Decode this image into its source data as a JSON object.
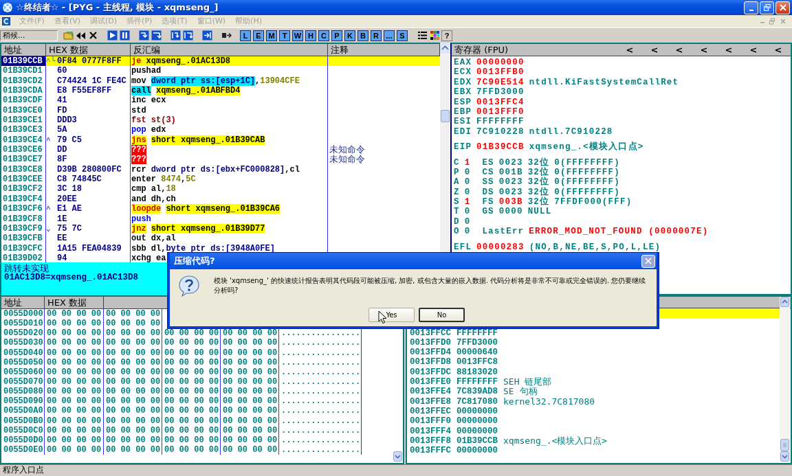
{
  "window": {
    "title": "☆终结者☆ - [PYG - 主线程, 模块 - xqmseng_]"
  },
  "menu": [
    {
      "label": "文件(F)",
      "disabled": true
    },
    {
      "label": "查看(V)",
      "disabled": true
    },
    {
      "label": "调试(D)",
      "disabled": true
    },
    {
      "label": "插件(P)",
      "disabled": true
    },
    {
      "label": "选项(T)",
      "disabled": true
    },
    {
      "label": "窗口(W)",
      "disabled": true
    },
    {
      "label": "帮助(H)",
      "disabled": true
    }
  ],
  "toolbar": {
    "status": "稍候...",
    "letter_buttons": [
      "L",
      "E",
      "M",
      "T",
      "W",
      "H",
      "C",
      "P",
      "K",
      "B",
      "R",
      "...",
      "S"
    ],
    "help_button": "?"
  },
  "disassembly": {
    "columns": [
      "地址",
      "HEX 数据",
      "反汇编",
      "注释"
    ],
    "rows": [
      {
        "address": "01B39CCB",
        "mark": "^╰",
        "hex": "0F84 0777F8FF",
        "selected": true,
        "code": [
          {
            "text": "je",
            "kind": "jump"
          },
          {
            "text": " xqmseng_.01AC13D8",
            "kind": "plain"
          }
        ]
      },
      {
        "address": "01B39CD1",
        "hex": "60",
        "selected": false,
        "code": [
          {
            "text": "pushad",
            "kind": "plain"
          }
        ]
      },
      {
        "address": "01B39CD2",
        "hex": "C74424 1C FE4C",
        "selected": false,
        "code": [
          {
            "text": "mov ",
            "kind": "plain"
          },
          {
            "text": "dword ptr ss:[esp+1C]",
            "kind": "memhl"
          },
          {
            "text": ",",
            "kind": "plain"
          },
          {
            "text": "13904CFE",
            "kind": "num"
          }
        ]
      },
      {
        "address": "01B39CDA",
        "hex": "E8 F55EF8FF",
        "selected": false,
        "code": [
          {
            "text": "call",
            "kind": "callhl"
          },
          {
            "text": "xqmseng_.01ABFBD4",
            "kind": "target"
          }
        ]
      },
      {
        "address": "01B39CDF",
        "hex": "41",
        "selected": false,
        "code": [
          {
            "text": "inc ecx",
            "kind": "plain"
          }
        ]
      },
      {
        "address": "01B39CE0",
        "hex": "FD",
        "selected": false,
        "code": [
          {
            "text": "std",
            "kind": "plain"
          }
        ]
      },
      {
        "address": "01B39CE1",
        "hex": "DDD3",
        "selected": false,
        "code": [
          {
            "text": "fst st(3)",
            "kind": "fpu"
          }
        ]
      },
      {
        "address": "01B39CE3",
        "hex": "5A",
        "selected": false,
        "code": [
          {
            "text": "pop",
            "kind": "stackop"
          },
          {
            "text": " edx",
            "kind": "plain"
          }
        ]
      },
      {
        "address": "01B39CE4",
        "mark": "^",
        "hex": "79 C5",
        "selected": false,
        "code": [
          {
            "text": "jns",
            "kind": "jump"
          },
          {
            "text": "short xqmseng_.01B39CAB",
            "kind": "target"
          }
        ]
      },
      {
        "address": "01B39CE6",
        "hex": "DD",
        "selected": false,
        "code": [
          {
            "text": "???",
            "kind": "bad"
          }
        ],
        "comment": "未知命令"
      },
      {
        "address": "01B39CE7",
        "hex": "8F",
        "selected": false,
        "code": [
          {
            "text": "???",
            "kind": "bad"
          }
        ],
        "comment": "未知命令"
      },
      {
        "address": "01B39CE8",
        "hex": "D39B 280800FC",
        "selected": false,
        "code": [
          {
            "text": "rcr ",
            "kind": "plain"
          },
          {
            "text": "dword ptr ds:[ebx+FC000828]",
            "kind": "mem"
          },
          {
            "text": ",cl",
            "kind": "plain"
          }
        ]
      },
      {
        "address": "01B39CEE",
        "hex": "C8 74845C",
        "selected": false,
        "code": [
          {
            "text": "enter ",
            "kind": "plain"
          },
          {
            "text": "8474",
            "kind": "num"
          },
          {
            "text": ",",
            "kind": "plain"
          },
          {
            "text": "5C",
            "kind": "num"
          }
        ]
      },
      {
        "address": "01B39CF2",
        "hex": "3C 18",
        "selected": false,
        "code": [
          {
            "text": "cmp al,",
            "kind": "plain"
          },
          {
            "text": "18",
            "kind": "num"
          }
        ]
      },
      {
        "address": "01B39CF4",
        "hex": "20EE",
        "selected": false,
        "code": [
          {
            "text": "and dh,ch",
            "kind": "plain"
          }
        ]
      },
      {
        "address": "01B39CF6",
        "mark": "^",
        "hex": "E1 AE",
        "selected": false,
        "code": [
          {
            "text": "loopde",
            "kind": "jump"
          },
          {
            "text": "short xqmseng_.01B39CA6",
            "kind": "target"
          }
        ]
      },
      {
        "address": "01B39CF8",
        "hex": "1E",
        "selected": false,
        "code": [
          {
            "text": "push",
            "kind": "stackop"
          }
        ]
      },
      {
        "address": "01B39CF9",
        "mark": "⌄",
        "hex": "75 7C",
        "selected": false,
        "code": [
          {
            "text": "jnz",
            "kind": "jump"
          },
          {
            "text": "short xqmseng_.01B39D77",
            "kind": "target"
          }
        ]
      },
      {
        "address": "01B39CFB",
        "hex": "EE",
        "selected": false,
        "code": [
          {
            "text": "out dx,al",
            "kind": "plain"
          }
        ]
      },
      {
        "address": "01B39CFC",
        "hex": "1A15 FEA04839",
        "selected": false,
        "code": [
          {
            "text": "sbb dl,",
            "kind": "plain"
          },
          {
            "text": "byte ptr ds:[3948A0FE]",
            "kind": "mem"
          }
        ]
      },
      {
        "address": "01B39D02",
        "hex": "94",
        "selected": false,
        "code": [
          {
            "text": "xchg ea",
            "kind": "plain"
          }
        ]
      }
    ]
  },
  "info": [
    "跳转未实现",
    "01AC13D8=xqmseng_.01AC13D8"
  ],
  "registers": {
    "title": "寄存器 (FPU)",
    "arrows": [
      "<",
      "<",
      "<",
      "<",
      "<",
      "<",
      "<"
    ],
    "groups": [
      [
        [
          {
            "text": "EAX",
            "changed": false
          },
          {
            "text": "00000000",
            "changed": true
          }
        ],
        [
          {
            "text": "ECX",
            "changed": false
          },
          {
            "text": "0013FFB0",
            "changed": true
          }
        ],
        [
          {
            "text": "EDX",
            "changed": false
          },
          {
            "text": "7C90E514",
            "changed": true
          },
          {
            "text": "ntdll.KiFastSystemCallRet",
            "changed": false
          }
        ],
        [
          {
            "text": "EBX",
            "changed": false
          },
          {
            "text": "7FFD3000",
            "changed": false
          }
        ],
        [
          {
            "text": "ESP",
            "changed": false
          },
          {
            "text": "0013FFC4",
            "changed": true
          }
        ],
        [
          {
            "text": "EBP",
            "changed": false
          },
          {
            "text": "0013FFF0",
            "changed": true
          }
        ],
        [
          {
            "text": "ESI",
            "changed": false
          },
          {
            "text": "FFFFFFFF",
            "changed": false
          }
        ],
        [
          {
            "text": "EDI",
            "changed": false
          },
          {
            "text": "7C910228",
            "changed": false
          },
          {
            "text": "ntdll.7C910228",
            "changed": false
          }
        ]
      ],
      [
        [
          {
            "text": "EIP",
            "changed": false
          },
          {
            "text": "01B39CCB",
            "changed": true
          },
          {
            "text": "xqmseng_.<模块入口点>",
            "changed": false
          }
        ]
      ],
      [
        [
          {
            "text": "C",
            "changed": false
          },
          {
            "text": "1",
            "changed": true
          },
          {
            "text": "ES",
            "changed": false
          },
          {
            "text": "0023",
            "changed": false
          },
          {
            "text": "32位",
            "changed": false
          },
          {
            "text": "0(FFFFFFFF)",
            "changed": false
          }
        ],
        [
          {
            "text": "P",
            "changed": false
          },
          {
            "text": "0",
            "changed": false
          },
          {
            "text": "CS",
            "changed": false
          },
          {
            "text": "001B",
            "changed": false
          },
          {
            "text": "32位",
            "changed": false
          },
          {
            "text": "0(FFFFFFFF)",
            "changed": false
          }
        ],
        [
          {
            "text": "A",
            "changed": false
          },
          {
            "text": "0",
            "changed": false
          },
          {
            "text": "SS",
            "changed": false
          },
          {
            "text": "0023",
            "changed": false
          },
          {
            "text": "32位",
            "changed": false
          },
          {
            "text": "0(FFFFFFFF)",
            "changed": false
          }
        ],
        [
          {
            "text": "Z",
            "changed": false
          },
          {
            "text": "0",
            "changed": false
          },
          {
            "text": "DS",
            "changed": false
          },
          {
            "text": "0023",
            "changed": false
          },
          {
            "text": "32位",
            "changed": false
          },
          {
            "text": "0(FFFFFFFF)",
            "changed": false
          }
        ],
        [
          {
            "text": "S",
            "changed": false
          },
          {
            "text": "1",
            "changed": true
          },
          {
            "text": "FS",
            "changed": false
          },
          {
            "text": "003B",
            "changed": true
          },
          {
            "text": "32位",
            "changed": false
          },
          {
            "text": "7FFDF000(FFF)",
            "changed": false
          }
        ],
        [
          {
            "text": "T",
            "changed": false
          },
          {
            "text": "0",
            "changed": false
          },
          {
            "text": "GS",
            "changed": false
          },
          {
            "text": "0000",
            "changed": false
          },
          {
            "text": "NULL",
            "changed": false
          }
        ],
        [
          {
            "text": "D",
            "changed": false
          },
          {
            "text": "0",
            "changed": false
          }
        ],
        [
          {
            "text": "O",
            "changed": false
          },
          {
            "text": "0",
            "changed": false
          },
          {
            "text": "LastErr",
            "changed": false
          },
          {
            "text": "ERROR_MOD_NOT_FOUND (0000007E)",
            "changed": true
          }
        ]
      ],
      [
        [
          {
            "text": "EFL",
            "changed": false
          },
          {
            "text": "00000283",
            "changed": true
          },
          {
            "text": "(NO,B,NE,BE,S,PO,L,LE)",
            "changed": false
          }
        ]
      ]
    ]
  },
  "dump": {
    "columns": [
      "地址",
      "HEX 数据"
    ],
    "rows": [
      {
        "address": "0055D000",
        "groups": [
          "00 00 00 00",
          "00 00 00 00"
        ]
      },
      {
        "address": "0055D010",
        "groups": [
          "00 00 00 00",
          "00 00 00 00"
        ]
      },
      {
        "address": "0055D020",
        "groups": [
          "00 00 00 00",
          "00 00 00 00",
          "00 00 00 00",
          "00 00 00 00"
        ],
        "ascii": "................"
      },
      {
        "address": "0055D030",
        "groups": [
          "00 00 00 00",
          "00 00 00 00",
          "00 00 00 00",
          "00 00 00 00"
        ],
        "ascii": "................"
      },
      {
        "address": "0055D040",
        "groups": [
          "00 00 00 00",
          "00 00 00 00",
          "00 00 00 00",
          "00 00 00 00"
        ],
        "ascii": "................"
      },
      {
        "address": "0055D050",
        "groups": [
          "00 00 00 00",
          "00 00 00 00",
          "00 00 00 00",
          "00 00 00 00"
        ],
        "ascii": "................"
      },
      {
        "address": "0055D060",
        "groups": [
          "00 00 00 00",
          "00 00 00 00",
          "00 00 00 00",
          "00 00 00 00"
        ],
        "ascii": "................"
      },
      {
        "address": "0055D070",
        "groups": [
          "00 00 00 00",
          "00 00 00 00",
          "00 00 00 00",
          "00 00 00 00"
        ],
        "ascii": "................"
      },
      {
        "address": "0055D080",
        "groups": [
          "00 00 00 00",
          "00 00 00 00",
          "00 00 00 00",
          "00 00 00 00"
        ],
        "ascii": "................"
      },
      {
        "address": "0055D090",
        "groups": [
          "00 00 00 00",
          "00 00 00 00",
          "00 00 00 00",
          "00 00 00 00"
        ],
        "ascii": "................"
      },
      {
        "address": "0055D0A0",
        "groups": [
          "00 00 00 00",
          "00 00 00 00",
          "00 00 00 00",
          "00 00 00 00"
        ],
        "ascii": "................"
      },
      {
        "address": "0055D0B0",
        "groups": [
          "00 00 00 00",
          "00 00 00 00",
          "00 00 00 00",
          "00 00 00 00"
        ],
        "ascii": "................"
      },
      {
        "address": "0055D0C0",
        "groups": [
          "00 00 00 00",
          "00 00 00 00",
          "00 00 00 00",
          "00 00 00 00"
        ],
        "ascii": "................"
      },
      {
        "address": "0055D0D0",
        "groups": [
          "00 00 00 00",
          "00 00 00 00",
          "00 00 00 00",
          "00 00 00 00"
        ],
        "ascii": "................"
      },
      {
        "address": "0055D0E0",
        "groups": [
          "00 00 00 00",
          "00 00 00 00",
          "00 00 00 00",
          "00 00 00 00"
        ],
        "ascii": "................"
      }
    ]
  },
  "stack": {
    "rows": [
      {
        "selected": true
      },
      {
        "selected": false
      },
      {
        "address": "0013FFCC",
        "value": "FFFFFFFF",
        "selected": false
      },
      {
        "address": "0013FFD0",
        "value": "7FFD3000",
        "selected": false
      },
      {
        "address": "0013FFD4",
        "value": "00000640",
        "selected": false
      },
      {
        "address": "0013FFD8",
        "value": "0013FFC8",
        "selected": false
      },
      {
        "address": "0013FFDC",
        "value": "88183020",
        "selected": false
      },
      {
        "address": "0013FFE0",
        "value": "FFFFFFFF",
        "comment": "SEH 链尾部",
        "selected": false
      },
      {
        "address": "0013FFE4",
        "value": "7C839AD8",
        "comment": "SE 句柄",
        "selected": false
      },
      {
        "address": "0013FFE8",
        "value": "7C817080",
        "comment": "kernel32.7C817080",
        "selected": false
      },
      {
        "address": "0013FFEC",
        "value": "00000000",
        "selected": false
      },
      {
        "address": "0013FFF0",
        "value": "00000000",
        "selected": false
      },
      {
        "address": "0013FFF4",
        "value": "00000000",
        "selected": false
      },
      {
        "address": "0013FFF8",
        "value": "01B39CCB",
        "comment": "xqmseng_.<模块入口点>",
        "selected": false
      },
      {
        "address": "0013FFFC",
        "value": "00000000",
        "selected": false
      }
    ]
  },
  "dialog": {
    "title": "压缩代码?",
    "message": "模块 'xqmseng_' 的快速统计报告表明其代码段可能被压缩, 加密, 或包含大量的嵌入数据. 代码分析将是非常不可靠或完全错误的. 您仍要继续分析吗?",
    "buttons": [
      "Yes",
      "No"
    ]
  },
  "status_bar": "程序入口点"
}
